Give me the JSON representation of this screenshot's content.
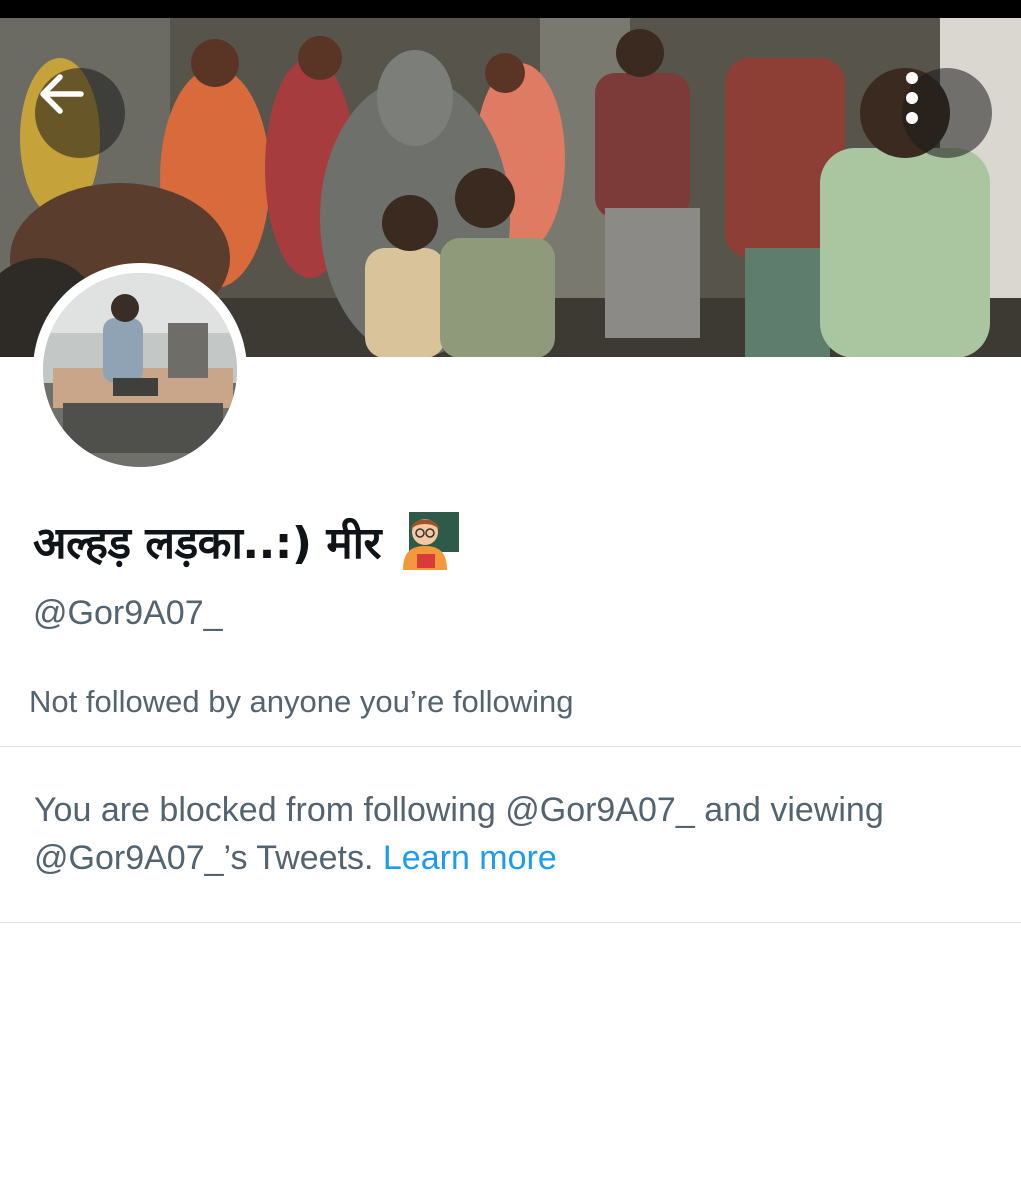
{
  "header": {
    "back_icon": "arrow-left-icon",
    "more_icon": "more-vertical-icon"
  },
  "profile": {
    "display_name": "अल्हड़ लड़का..:) मीर",
    "name_emoji": "teacher-emoji",
    "handle": "@Gor9A07_",
    "followers_note": "Not followed by anyone you’re following"
  },
  "blocked": {
    "message_line1": "You are blocked from following @Gor9A07_ and viewing",
    "message_line2": "@Gor9A07_’s Tweets.",
    "learn_more": "Learn more"
  },
  "colors": {
    "text_primary": "#0f1419",
    "text_secondary": "#536471",
    "link": "#1d9bf0",
    "divider": "#dfe3e6"
  }
}
